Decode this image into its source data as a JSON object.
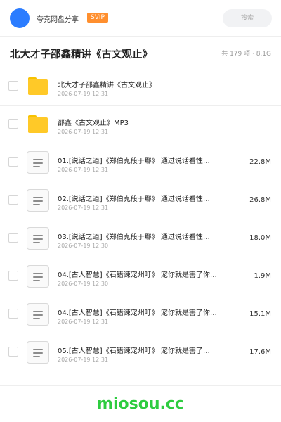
{
  "header": {
    "share_name": "夸克网盘分享",
    "vip_badge": "SVIP",
    "search_placeholder": "搜索"
  },
  "title_bar": {
    "title": "北大才子邵鑫精讲《古文观止》",
    "summary": "共 179 项 · 8.1G"
  },
  "files": [
    {
      "type": "folder",
      "name": "北大才子邵鑫精讲《古文观止》",
      "date": "2026-07-19 12:31",
      "size": ""
    },
    {
      "type": "folder",
      "name": "邵鑫《古文观止》MP3",
      "date": "2026-07-19 12:31",
      "size": ""
    },
    {
      "type": "doc",
      "name": "01.[说话之道]《郑伯克段于鄢》 通过说话看性…",
      "date": "2026-07-19 12:31",
      "size": "22.8M"
    },
    {
      "type": "doc",
      "name": "02.[说话之道]《郑伯克段于鄢》 通过说话看性…",
      "date": "2026-07-19 12:31",
      "size": "26.8M"
    },
    {
      "type": "doc",
      "name": "03.[说话之道]《郑伯克段于鄢》 通过说话看性…",
      "date": "2026-07-19 12:30",
      "size": "18.0M"
    },
    {
      "type": "doc",
      "name": "04.[古人智慧]《石错谏宠州吁》 宠你就是害了你…",
      "date": "2026-07-19 12:30",
      "size": "1.9M"
    },
    {
      "type": "doc",
      "name": "04.[古人智慧]《石错谏宠州吁》 宠你就是害了你…",
      "date": "2026-07-19 12:31",
      "size": "15.1M"
    },
    {
      "type": "doc",
      "name": "05.[古人智慧]《石错谏宠州吁》 宠你就是害了…",
      "date": "2026-07-19 12:31",
      "size": "17.6M"
    }
  ],
  "watermark": "miosou.cc",
  "colors": {
    "accent": "#2b7cff",
    "vip": "#ff8f2e",
    "folder": "#ffc928",
    "watermark": "#2ecc40"
  }
}
